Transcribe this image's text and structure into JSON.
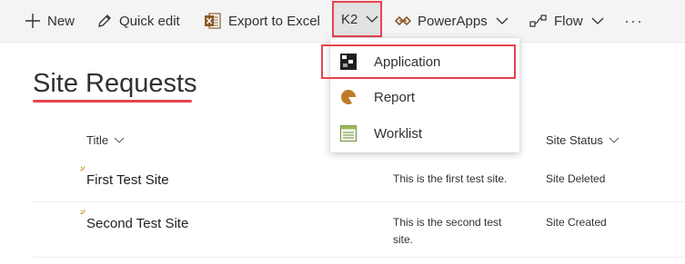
{
  "commandbar": {
    "new_label": "New",
    "quick_edit_label": "Quick edit",
    "export_label": "Export to Excel",
    "k2_label": "K2",
    "powerapps_label": "PowerApps",
    "flow_label": "Flow",
    "more_label": "···"
  },
  "page": {
    "title": "Site Requests"
  },
  "columns": {
    "title": "Title",
    "status": "Site Status"
  },
  "rows": [
    {
      "title": "First Test Site",
      "description": "This is the first test site.",
      "status": "Site Deleted"
    },
    {
      "title": "Second Test Site",
      "description": "This is the second test site.",
      "status": "Site Created"
    }
  ],
  "k2_menu": {
    "items": [
      {
        "label": "Application",
        "icon": "application-icon"
      },
      {
        "label": "Report",
        "icon": "report-icon"
      },
      {
        "label": "Worklist",
        "icon": "worklist-icon"
      }
    ]
  },
  "colors": {
    "accent": "#e8434e",
    "excel": "#8a5a2b",
    "powerapps": "#8a5a2b"
  }
}
